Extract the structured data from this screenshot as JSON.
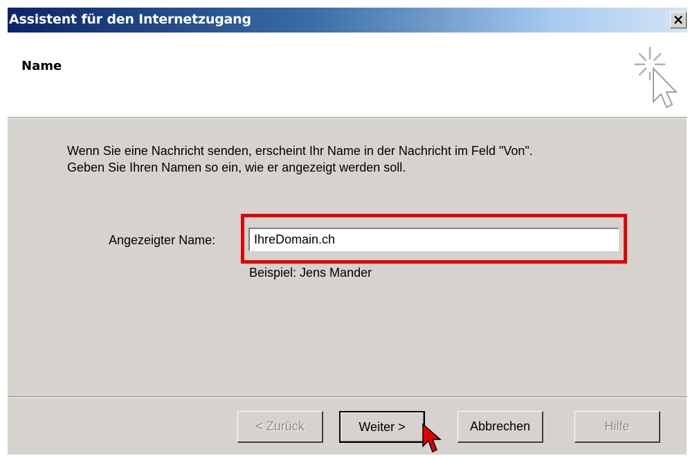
{
  "window": {
    "title": "Assistent für den Internetzugang",
    "close_glyph": "×"
  },
  "header": {
    "title": "Name",
    "icon": "wizard-sparkle-cursor-icon"
  },
  "body": {
    "instruction_line1": "Wenn Sie eine Nachricht senden, erscheint Ihr Name in der Nachricht im Feld \"Von\".",
    "instruction_line2": "Geben Sie Ihren Namen so ein, wie er angezeigt werden soll.",
    "name_label": "Angezeigter Name:",
    "name_value": "IhreDomain.ch",
    "example": "Beispiel: Jens Mander"
  },
  "buttons": {
    "back": "< Zurück",
    "next": "Weiter >",
    "cancel": "Abbrechen",
    "help": "Hilfe"
  },
  "colors": {
    "highlight": "#e50000",
    "titlebar_start": "#0a246a",
    "face": "#d6d3ce"
  }
}
